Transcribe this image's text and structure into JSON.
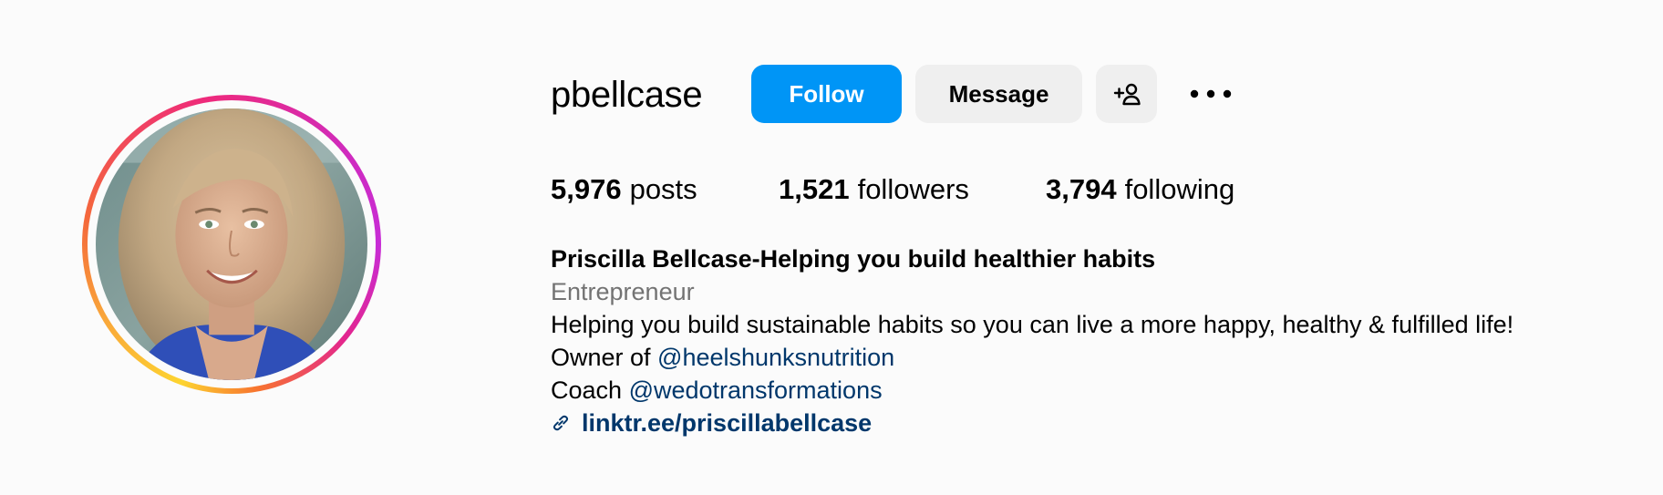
{
  "profile": {
    "username": "pbellcase",
    "avatar_alt": "Profile photo",
    "buttons": {
      "follow": "Follow",
      "message": "Message",
      "add_user_icon": "add-user-icon",
      "more_icon": "more-horizontal-icon"
    },
    "stats": {
      "posts_count": "5,976",
      "posts_label": "posts",
      "followers_count": "1,521",
      "followers_label": "followers",
      "following_count": "3,794",
      "following_label": "following"
    },
    "bio": {
      "name": "Priscilla Bellcase-Helping you build healthier habits",
      "category": "Entrepreneur",
      "line1": "Helping you build sustainable habits so you can live a more happy, healthy & fulfilled life!",
      "owner_prefix": "Owner of ",
      "owner_mention": "@heelshunksnutrition",
      "coach_prefix": "Coach ",
      "coach_mention": "@wedotransformations",
      "link_text": "linktr.ee/priscillabellcase",
      "link_icon": "link-icon"
    }
  },
  "colors": {
    "follow_bg": "#0095f6",
    "secondary_btn_bg": "#efefef",
    "link": "#00376b",
    "muted": "#737373",
    "background": "#fbfbfb"
  }
}
